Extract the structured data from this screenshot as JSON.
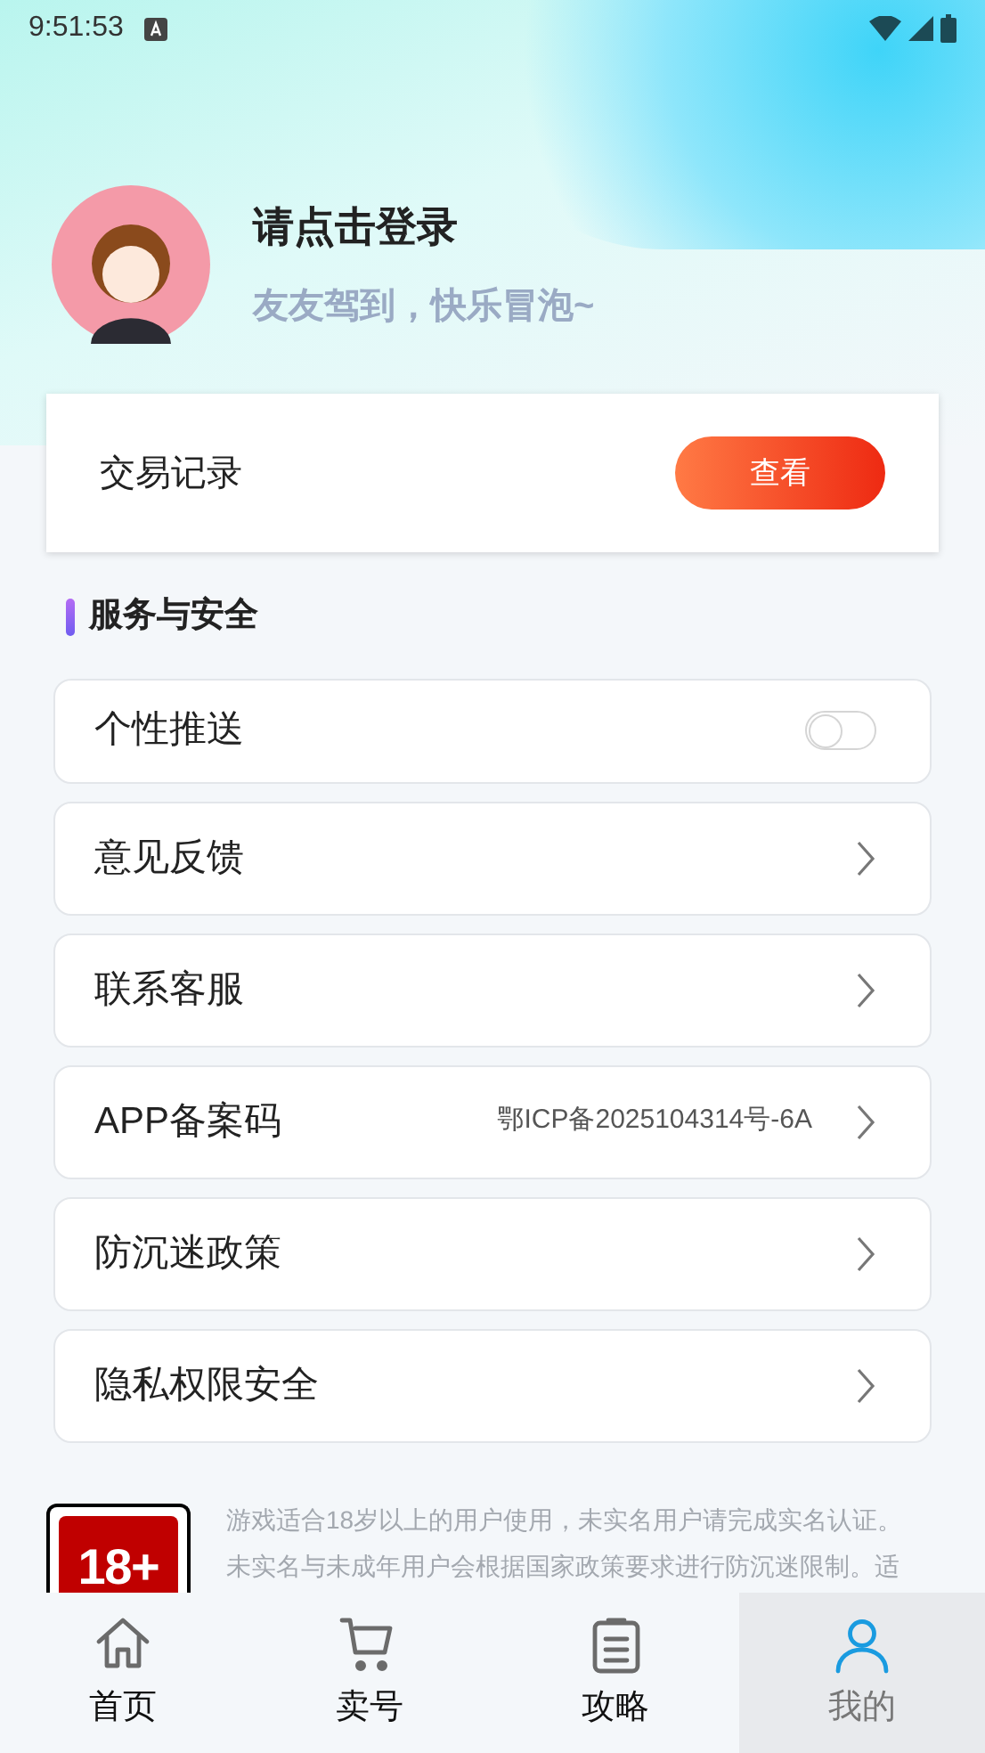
{
  "status_bar": {
    "time": "9:51:53"
  },
  "profile": {
    "title": "请点击登录",
    "subtitle": "友友驾到，快乐冒泡~"
  },
  "transactions": {
    "label": "交易记录",
    "button": "查看"
  },
  "section": {
    "title": "服务与安全"
  },
  "settings": [
    {
      "kind": "toggle",
      "label": "个性推送",
      "on": false
    },
    {
      "kind": "link",
      "label": "意见反馈"
    },
    {
      "kind": "link",
      "label": "联系客服"
    },
    {
      "kind": "link",
      "label": "APP备案码",
      "value": "鄂ICP备2025104314号-6A"
    },
    {
      "kind": "link",
      "label": "防沉迷政策"
    },
    {
      "kind": "link",
      "label": "隐私权限安全"
    }
  ],
  "notice": {
    "badge": "18+",
    "lines": [
      "游戏适合18岁以上的用户使用，未实名用户请完成实名认证。",
      "未实名与未成年用户会根据国家政策要求进行防沉迷限制。适"
    ]
  },
  "nav": [
    {
      "label": "首页",
      "kind": "home",
      "selected": false
    },
    {
      "label": "卖号",
      "kind": "cart",
      "selected": false
    },
    {
      "label": "攻略",
      "kind": "clipboard",
      "selected": false
    },
    {
      "label": "我的",
      "kind": "user",
      "selected": true
    }
  ]
}
